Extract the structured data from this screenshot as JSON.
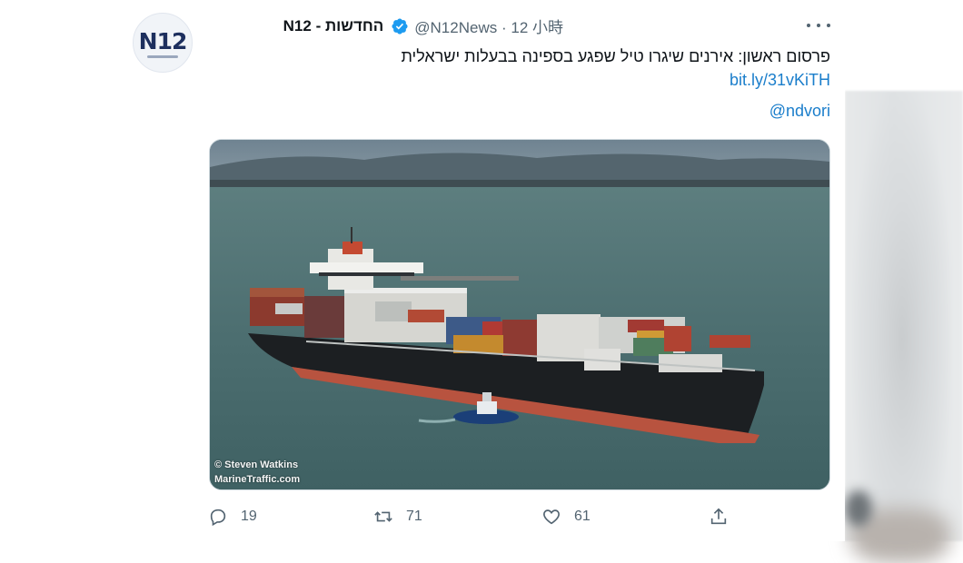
{
  "tweet": {
    "display_name": "N12 - החדשות",
    "handle": "@N12News",
    "separator": "·",
    "time": "12 小時",
    "verified_icon": "verified-badge-icon",
    "avatar_logo": "N12",
    "text": "פרסום ראשון: אירנים שיגרו טיל שפגע בספינה בבעלות ישראלית",
    "link": "bit.ly/31vKiTH",
    "mention": "@ndvori"
  },
  "media": {
    "watermark_line1": "© Steven Watkins",
    "watermark_line2": "MarineTraffic.com"
  },
  "actions": {
    "reply_count": "19",
    "retweet_count": "71",
    "like_count": "61",
    "reply_icon": "reply-icon",
    "retweet_icon": "retweet-icon",
    "like_icon": "heart-icon",
    "share_icon": "share-icon",
    "more_icon": "more-icon"
  },
  "colors": {
    "link": "#1b7ecb",
    "verified": "#1d9bf0",
    "muted": "#536471"
  }
}
